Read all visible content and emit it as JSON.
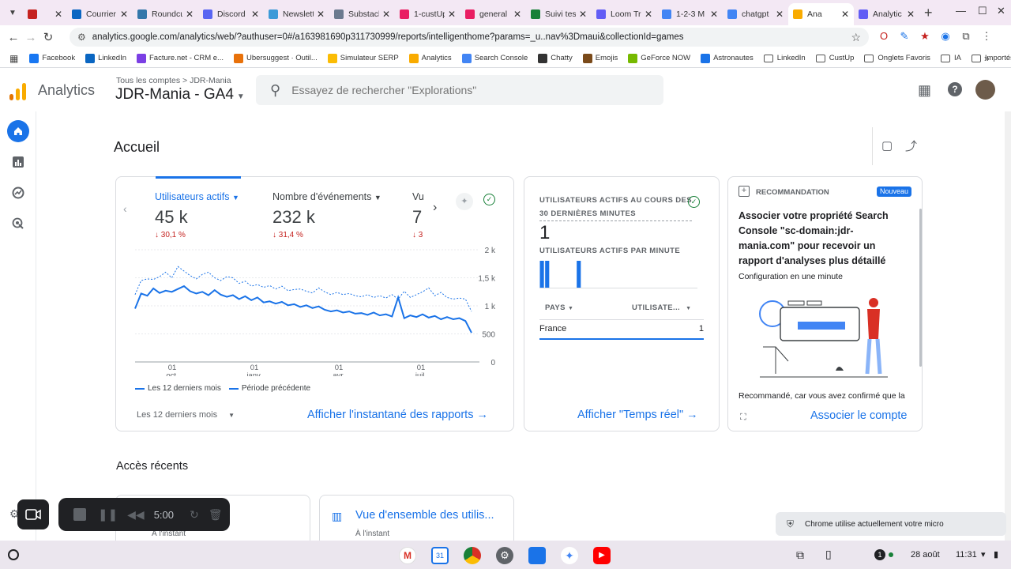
{
  "browser": {
    "tabs": [
      {
        "title": "",
        "active": false,
        "color": "#c5221f"
      },
      {
        "title": "Courrier",
        "active": false,
        "color": "#0a66c2"
      },
      {
        "title": "Roundcube",
        "active": false,
        "color": "#37a"
      },
      {
        "title": "Discord",
        "active": false,
        "color": "#5865f2"
      },
      {
        "title": "Newsletter",
        "active": false,
        "color": "#3c9ad8"
      },
      {
        "title": "Substack",
        "active": false,
        "color": "#6b7a8f"
      },
      {
        "title": "1-custUp",
        "active": false,
        "color": "#e91e63"
      },
      {
        "title": "general",
        "active": false,
        "color": "#e91e63"
      },
      {
        "title": "Suivi tes",
        "active": false,
        "color": "#188038"
      },
      {
        "title": "Loom Tr",
        "active": false,
        "color": "#625df5"
      },
      {
        "title": "1-2-3 M",
        "active": false,
        "color": "#4285f4"
      },
      {
        "title": "chatgpt",
        "active": false,
        "color": "#4285f4"
      },
      {
        "title": "Ana",
        "active": true,
        "color": "#f9ab00"
      },
      {
        "title": "Analytic",
        "active": false,
        "color": "#625df5"
      }
    ],
    "url": "analytics.google.com/analytics/web/?authuser=0#/a163981690p311730999/reports/intelligenthome?params=_u..nav%3Dmaui&collectionId=games",
    "bookmarks": [
      {
        "label": "Facebook",
        "color": "#1877f2",
        "folder": false
      },
      {
        "label": "LinkedIn",
        "color": "#0a66c2",
        "folder": false
      },
      {
        "label": "Facture.net - CRM e...",
        "color": "#7b3fe4",
        "folder": false
      },
      {
        "label": "Ubersuggest · Outil...",
        "color": "#e8710a",
        "folder": false
      },
      {
        "label": "Simulateur SERP",
        "color": "#fbbc04",
        "folder": false
      },
      {
        "label": "Analytics",
        "color": "#f9ab00",
        "folder": false
      },
      {
        "label": "Search Console",
        "color": "#4285f4",
        "folder": false
      },
      {
        "label": "Chatty",
        "color": "#333333",
        "folder": false
      },
      {
        "label": "Emojis",
        "color": "#7a4a1a",
        "folder": false
      },
      {
        "label": "GeForce NOW",
        "color": "#76b900",
        "folder": false
      },
      {
        "label": "Astronautes",
        "color": "#1a73e8",
        "folder": false
      },
      {
        "label": "LinkedIn",
        "color": "",
        "folder": true
      },
      {
        "label": "CustUp",
        "color": "",
        "folder": true
      },
      {
        "label": "Onglets Favoris",
        "color": "",
        "folder": true
      },
      {
        "label": "IA",
        "color": "",
        "folder": true
      },
      {
        "label": "Importés",
        "color": "",
        "folder": true
      }
    ]
  },
  "header": {
    "product": "Analytics",
    "breadcrumb": "Tous les comptes  >  JDR-Mania",
    "property": "JDR-Mania  - GA4",
    "search_placeholder": "Essayez de rechercher \"Explorations\""
  },
  "page": {
    "title": "Accueil"
  },
  "overview": {
    "metrics": [
      {
        "label": "Utilisateurs actifs",
        "value": "45 k",
        "delta": "30,1 %",
        "selected": true
      },
      {
        "label": "Nombre d'événements",
        "value": "232 k",
        "delta": "31,4 %",
        "selected": false
      },
      {
        "label": "Vu",
        "value": "7",
        "delta": "3",
        "selected": false
      }
    ],
    "legend_current": "Les 12 derniers mois",
    "legend_previous": "Période précédente",
    "period": "Les 12 derniers mois",
    "link": "Afficher l'instantané des rapports"
  },
  "chart_data": {
    "type": "line",
    "x": [
      "01 oct.",
      "01 janv.",
      "01 avr.",
      "01 juil."
    ],
    "y_ticks": [
      "2 k",
      "1,5 k",
      "1 k",
      "500",
      "0"
    ],
    "ylim": [
      0,
      2000
    ],
    "series": [
      {
        "name": "Les 12 derniers mois",
        "values": [
          950,
          1220,
          1180,
          1310,
          1230,
          1270,
          1250,
          1300,
          1350,
          1260,
          1220,
          1250,
          1190,
          1280,
          1200,
          1160,
          1190,
          1120,
          1170,
          1100,
          1150,
          1060,
          1080,
          1040,
          1070,
          1010,
          1030,
          980,
          1010,
          960,
          990,
          930,
          900,
          920,
          880,
          900,
          860,
          870,
          840,
          880,
          830,
          850,
          810,
          1150,
          780,
          830,
          800,
          850,
          790,
          820,
          760,
          800,
          760,
          780,
          730,
          520
        ]
      },
      {
        "name": "Période précédente",
        "values": [
          1200,
          1450,
          1480,
          1470,
          1520,
          1600,
          1500,
          1700,
          1620,
          1540,
          1480,
          1560,
          1600,
          1500,
          1450,
          1520,
          1500,
          1400,
          1440,
          1350,
          1380,
          1330,
          1360,
          1300,
          1350,
          1270,
          1290,
          1300,
          1260,
          1230,
          1320,
          1250,
          1200,
          1240,
          1200,
          1220,
          1180,
          1160,
          1200,
          1150,
          1180,
          1140,
          1200,
          1120,
          1260,
          1150,
          1200,
          1250,
          1320,
          1180,
          1240,
          1150,
          1120,
          1140,
          1120,
          900
        ]
      }
    ]
  },
  "realtime": {
    "title_line1": "UTILISATEURS ACTIFS AU COURS DES",
    "title_line2": "30 DERNIÈRES MINUTES",
    "value": "1",
    "sub": "UTILISATEURS ACTIFS PAR MINUTE",
    "bars": [
      1,
      1,
      0,
      0,
      0,
      0,
      0,
      1,
      0,
      0,
      0,
      0,
      0,
      0,
      0,
      0,
      0,
      0,
      0,
      0,
      0,
      0,
      0,
      0,
      0,
      0,
      0,
      0,
      0,
      0
    ],
    "col_country": "PAYS",
    "col_users": "UTILISATE...",
    "rows": [
      {
        "country": "France",
        "users": "1"
      }
    ],
    "link": "Afficher \"Temps réel\""
  },
  "recommendation": {
    "heading": "RECOMMANDATION",
    "badge": "Nouveau",
    "title": "Associer votre propriété Search Console \"sc-domain:jdr-mania.com\" pour recevoir un rapport d'analyses plus détaillé",
    "sub": "Configuration en une minute",
    "reason": "Recommandé, car vous avez confirmé que la",
    "action": "Associer le compte"
  },
  "recent": {
    "title": "Accès récents",
    "cards": [
      {
        "title": "",
        "time": "À l'instant"
      },
      {
        "title": "Vue d'ensemble des utilis...",
        "time": "À l'instant"
      }
    ]
  },
  "recorder": {
    "time": "5:00"
  },
  "toast": {
    "text": "Chrome utilise actuellement votre micro"
  },
  "shelf": {
    "badge": "1",
    "date": "28 août",
    "time": "11:31"
  }
}
